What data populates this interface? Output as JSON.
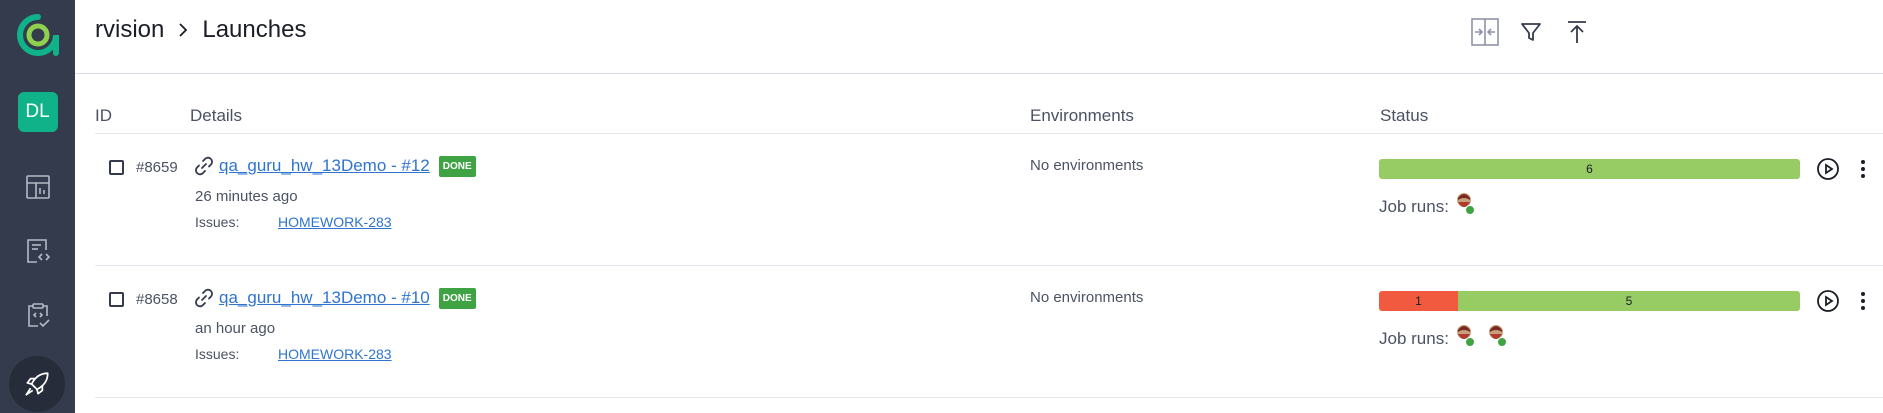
{
  "sidebar": {
    "avatar_initials": "DL",
    "items": [
      {
        "name": "dashboards",
        "icon": "dashboard-icon"
      },
      {
        "name": "test-cases",
        "icon": "testcases-icon"
      },
      {
        "name": "test-plans",
        "icon": "testplans-icon"
      },
      {
        "name": "launches",
        "icon": "rocket-icon",
        "active": true
      }
    ]
  },
  "header": {
    "project": "rvision",
    "page": "Launches"
  },
  "table": {
    "columns": {
      "id": "ID",
      "details": "Details",
      "environments": "Environments",
      "status": "Status"
    },
    "rows": [
      {
        "id": "#8659",
        "name": "qa_guru_hw_13Demo - #12",
        "badge": "DONE",
        "time": "26 minutes ago",
        "issues_label": "Issues:",
        "issue": "HOMEWORK-283",
        "environments": "No environments",
        "status_segments": [
          {
            "status": "passed",
            "count": "6",
            "fraction": 1.0
          }
        ],
        "jobruns_label": "Job runs:",
        "jobruns_count": 1
      },
      {
        "id": "#8658",
        "name": "qa_guru_hw_13Demo - #10",
        "badge": "DONE",
        "time": "an hour ago",
        "issues_label": "Issues:",
        "issue": "HOMEWORK-283",
        "environments": "No environments",
        "status_segments": [
          {
            "status": "failed",
            "count": "1",
            "fraction": 0.1875
          },
          {
            "status": "passed",
            "count": "5",
            "fraction": 0.8125
          }
        ],
        "jobruns_label": "Job runs:",
        "jobruns_count": 2
      }
    ]
  },
  "colors": {
    "sidebar": "#343b4c",
    "accent": "#10b289",
    "passed": "#97cc64",
    "failed": "#f15a3f",
    "done_badge": "#3fa344",
    "link": "#2f74d0"
  }
}
